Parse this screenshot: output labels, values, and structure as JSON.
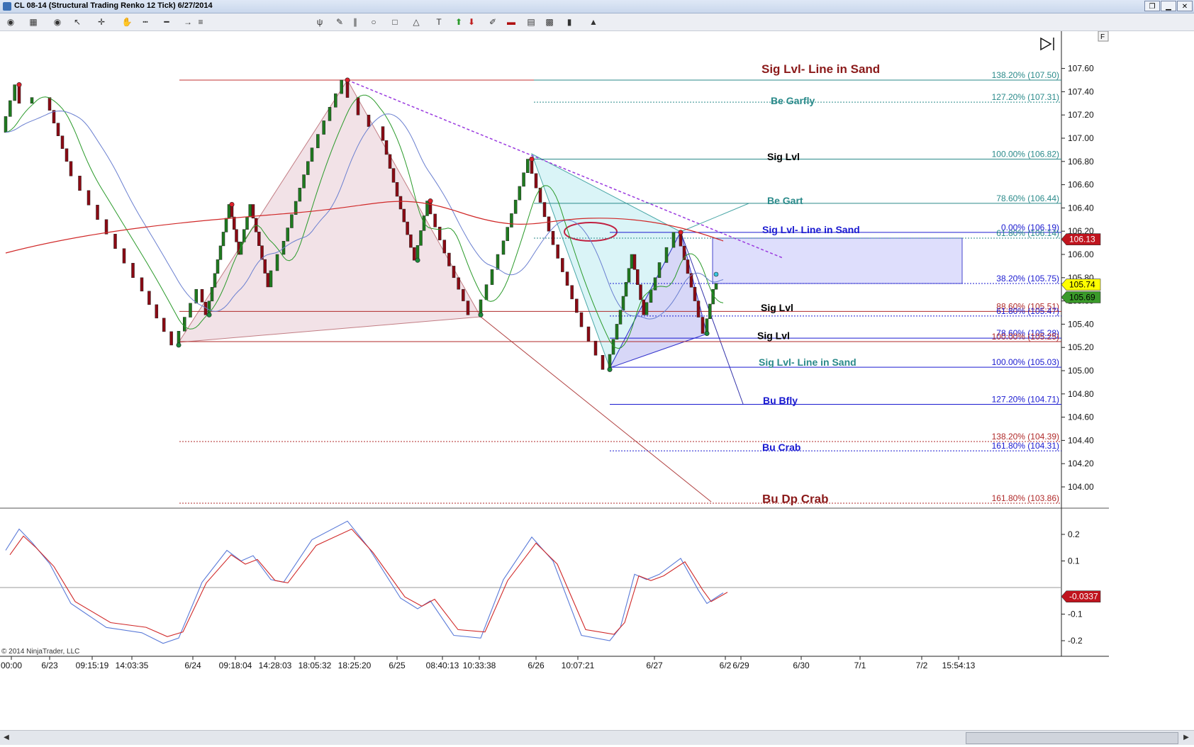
{
  "window": {
    "title": "CL 08-14 (Structural Trading Renko 12 Tick)  6/27/2014"
  },
  "copyright": "© 2014 NinjaTrader, LLC",
  "icons": [
    "eye-icon",
    "bar-type-icon",
    "eye-icon",
    "pointer-icon",
    "crosshair-icon",
    "hand-icon",
    "line-style-icon",
    "line-width-icon",
    "arrow-line-icon",
    "fib-icon",
    "pitchfork-icon",
    "pencil-icon",
    "parallel-lines-icon",
    "ellipse-icon",
    "rectangle-icon",
    "triangle-icon",
    "text-icon",
    "arrow-up-icon",
    "arrow-down-icon",
    "pen-icon",
    "record-icon",
    "data-box-icon",
    "chart-trader-icon",
    "bars-icon",
    "strategy-icon"
  ],
  "chart_data": {
    "type": "candlestick",
    "price_axis": {
      "min": 103.86,
      "max": 107.66,
      "ticks": [
        "107.60",
        "107.40",
        "107.20",
        "107.00",
        "106.80",
        "106.60",
        "106.40",
        "106.20",
        "106.00",
        "105.80",
        "105.60",
        "105.40",
        "105.20",
        "105.00",
        "104.80",
        "104.60",
        "104.40",
        "104.20",
        "104.00"
      ]
    },
    "price_markers": [
      {
        "value": "106.13",
        "price": 106.13,
        "color": "#c0141e",
        "text_color": "#ffffff"
      },
      {
        "value": "105.74",
        "price": 105.74,
        "color": "#ffff00",
        "text_color": "#000000"
      },
      {
        "value": "105.69",
        "price": 105.68,
        "color": "#3a9a2a",
        "text_color": "#000000"
      }
    ],
    "fib_levels": [
      {
        "label": "138.20% (107.50)",
        "price": 107.5,
        "color": "#2a8a8a"
      },
      {
        "label": "127.20% (107.31)",
        "price": 107.31,
        "color": "#2a8a8a"
      },
      {
        "label": "100.00% (106.82)",
        "price": 106.82,
        "color": "#2a8a8a"
      },
      {
        "label": "78.60% (106.44)",
        "price": 106.44,
        "color": "#2a8a8a"
      },
      {
        "label": "0.00% (106.19)",
        "price": 106.19,
        "color": "#1a1ad0"
      },
      {
        "label": "61.80% (106.14)",
        "price": 106.14,
        "color": "#2a8a8a"
      },
      {
        "label": "38.20% (105.75)",
        "price": 105.75,
        "color": "#1a1ad0"
      },
      {
        "label": "88.60% (105.51)",
        "price": 105.51,
        "color": "#b02a2a"
      },
      {
        "label": "61.80% (105.47)",
        "price": 105.47,
        "color": "#1a1ad0"
      },
      {
        "label": "78.60% (105.28)",
        "price": 105.28,
        "color": "#1a1ad0"
      },
      {
        "label": "100.00% (105.25)",
        "price": 105.25,
        "color": "#b02a2a"
      },
      {
        "label": "100.00% (105.03)",
        "price": 105.03,
        "color": "#1a1ad0"
      },
      {
        "label": "127.20% (104.71)",
        "price": 104.71,
        "color": "#1a1ad0"
      },
      {
        "label": "138.20% (104.39)",
        "price": 104.39,
        "color": "#b02a2a"
      },
      {
        "label": "161.80% (104.31)",
        "price": 104.31,
        "color": "#1a1ad0"
      },
      {
        "label": "161.80% (103.86)",
        "price": 103.86,
        "color": "#b02a2a"
      }
    ],
    "annotations": [
      {
        "text": "Sig Lvl- Line in Sand",
        "price": 107.55,
        "color": "#8b1a1a"
      },
      {
        "text": "Be Garfly",
        "price": 107.28,
        "color": "#2a8a8a"
      },
      {
        "text": "Sig Lvl",
        "price": 106.8,
        "color": "#000000"
      },
      {
        "text": "Be Gart",
        "price": 106.42,
        "color": "#2a8a8a"
      },
      {
        "text": "Sig Lvl- Line in Sand",
        "price": 106.17,
        "color": "#1a1ad0"
      },
      {
        "text": "Sig Lvl",
        "price": 105.5,
        "color": "#000000"
      },
      {
        "text": "Sig Lvl",
        "price": 105.26,
        "color": "#000000"
      },
      {
        "text": "Sig Lvl- Line in Sand",
        "price": 105.03,
        "color": "#2a8a8a"
      },
      {
        "text": "Bu Bfly",
        "price": 104.7,
        "color": "#1a1ad0"
      },
      {
        "text": "Bu Crab",
        "price": 104.3,
        "color": "#1a1ad0"
      },
      {
        "text": "Bu Dp Crab",
        "price": 103.85,
        "color": "#8b1a1a"
      }
    ],
    "x_labels": [
      "00:00",
      "6/23",
      "09:15:19",
      "14:03:35",
      "6/24",
      "09:18:04",
      "14:28:03",
      "18:05:32",
      "18:25:20",
      "6/25",
      "08:40:13",
      "10:33:38",
      "6/26",
      "10:07:21",
      "6/27",
      "6/2",
      "6/29",
      "6/30",
      "7/1",
      "7/2",
      "15:54:13"
    ],
    "pivots": [
      {
        "price": 107.46,
        "type": "high"
      },
      {
        "price": 105.22,
        "type": "low"
      },
      {
        "price": 106.43,
        "type": "high"
      },
      {
        "price": 105.48,
        "type": "low"
      },
      {
        "price": 107.5,
        "type": "high"
      },
      {
        "price": 105.95,
        "type": "low"
      },
      {
        "price": 106.46,
        "type": "high"
      },
      {
        "price": 105.48,
        "type": "low"
      },
      {
        "price": 106.82,
        "type": "high"
      },
      {
        "price": 105.01,
        "type": "low"
      },
      {
        "price": 106.19,
        "type": "high"
      },
      {
        "price": 105.32,
        "type": "low"
      }
    ],
    "oscillator": {
      "ticks": [
        "0.2",
        "0.1",
        "-0.1",
        "-0.2"
      ],
      "range": [
        -0.23,
        0.26
      ],
      "zero": 0.0,
      "last_value": "-0.0337",
      "series": [
        "blue",
        "red"
      ]
    }
  }
}
